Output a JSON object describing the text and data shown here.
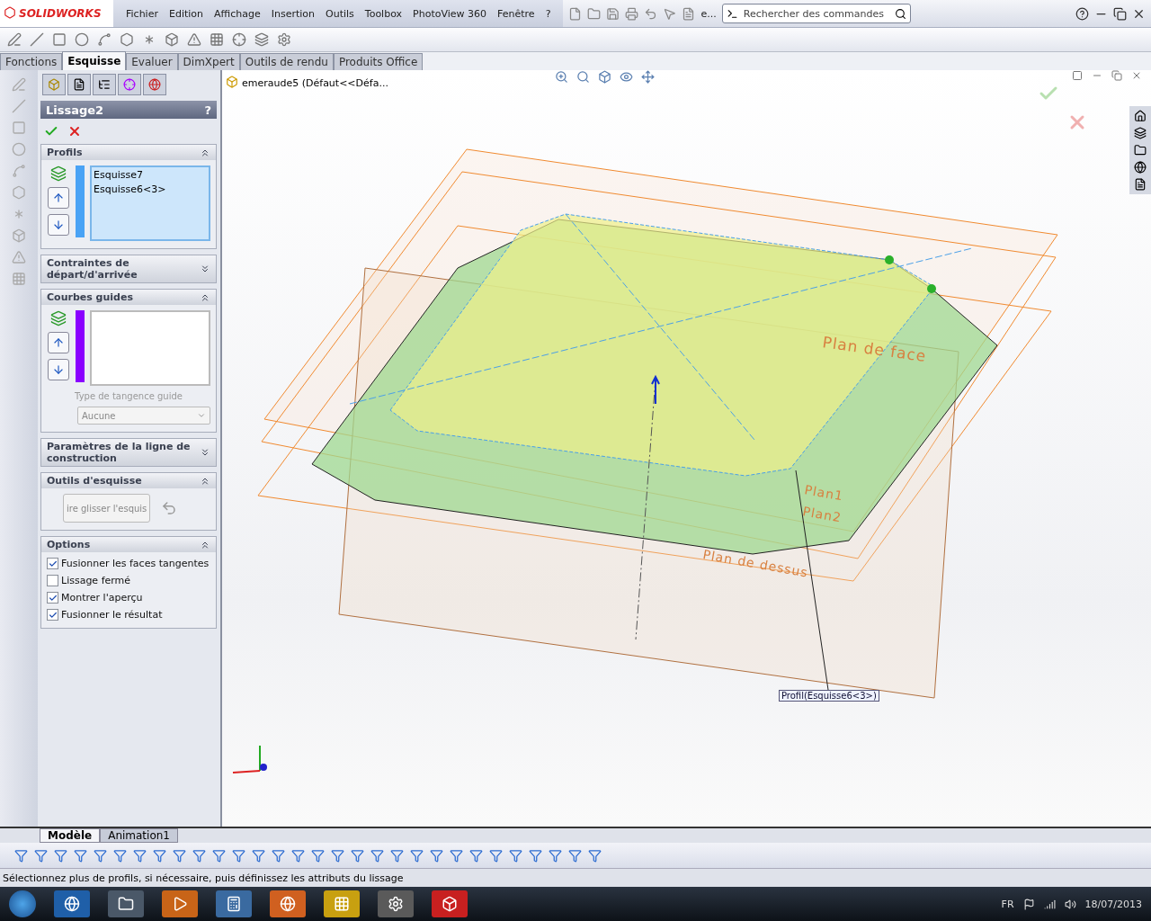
{
  "app": {
    "logo": "SOLIDWORKS"
  },
  "menu": [
    "Fichier",
    "Edition",
    "Affichage",
    "Insertion",
    "Outils",
    "Toolbox",
    "PhotoView 360",
    "Fenêtre",
    "?"
  ],
  "toolbar_overflow": "e...",
  "search": {
    "placeholder": "Rechercher des commandes"
  },
  "command_tabs": [
    {
      "label": "Fonctions",
      "selected": false
    },
    {
      "label": "Esquisse",
      "selected": true
    },
    {
      "label": "Evaluer",
      "selected": false
    },
    {
      "label": "DimXpert",
      "selected": false
    },
    {
      "label": "Outils de rendu",
      "selected": false
    },
    {
      "label": "Produits Office",
      "selected": false
    }
  ],
  "tree": {
    "part": "emeraude5  (Défaut<<Défa..."
  },
  "property_manager": {
    "title": "Lissage2",
    "help": "?",
    "sections": [
      {
        "kind": "list",
        "title": "Profils",
        "expanded": true,
        "color": "#4aa3f5",
        "items": [
          "Esquisse7",
          "Esquisse6<3>"
        ]
      },
      {
        "kind": "collapsed",
        "title": "Contraintes de départ/d'arrivée",
        "expanded": false
      },
      {
        "kind": "list",
        "title": "Courbes guides",
        "expanded": true,
        "color": "#8a00ff",
        "tangency_label": "Type de tangence guide",
        "tangency_value": "Aucune"
      },
      {
        "kind": "collapsed",
        "title": "Paramètres de la ligne de construction",
        "expanded": false
      },
      {
        "kind": "tools",
        "title": "Outils d'esquisse",
        "expanded": true,
        "button": "ire glisser l'esquis"
      },
      {
        "kind": "options",
        "title": "Options",
        "expanded": true,
        "options": [
          {
            "label": "Fusionner les faces tangentes",
            "checked": true
          },
          {
            "label": "Lissage fermé",
            "checked": false
          },
          {
            "label": "Montrer l'aperçu",
            "checked": true
          },
          {
            "label": "Fusionner le résultat",
            "checked": true
          }
        ]
      }
    ]
  },
  "viewport": {
    "plane_labels": [
      "Plan de face",
      "Plan1",
      "Plan2",
      "Plan de dessus"
    ],
    "callout": "Profil(Esquisse6<3>)"
  },
  "bottom_tabs": [
    {
      "label": "Modèle",
      "selected": true
    },
    {
      "label": "Animation1",
      "selected": false
    }
  ],
  "status_bar": {
    "message": "Sélectionnez plus de profils, si nécessaire, puis définissez les attributs du lissage"
  },
  "taskbar": {
    "language": "FR",
    "date": "18/07/2013"
  }
}
